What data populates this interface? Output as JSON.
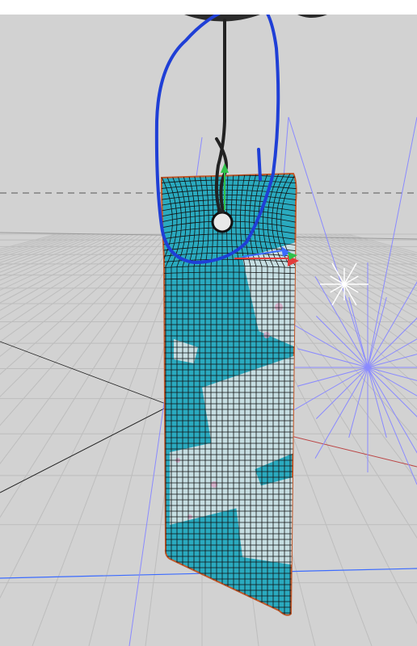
{
  "viewport": {
    "background": "#d2d2d2",
    "mode": "3d-perspective-wireframe"
  },
  "scene_objects": {
    "tag": {
      "color": "#2aaabf",
      "wire_color": "#111111",
      "outline_color": "#c0582a"
    },
    "hook": {
      "color": "#222222"
    },
    "light": {
      "color": "#8a8aff"
    },
    "sun": {
      "color": "#ffffff"
    },
    "gizmo": {
      "y_color": "#2fc24a",
      "x_color": "#e23b3b",
      "z_color": "#3b6bff"
    }
  },
  "annotation": {
    "shape": "freehand-loop",
    "color": "#1f3fd6"
  },
  "colors": {
    "grid": "#bcbcbc",
    "horizon": "#555555",
    "axis_x": "#b44",
    "axis_z": "#3b6bff"
  }
}
